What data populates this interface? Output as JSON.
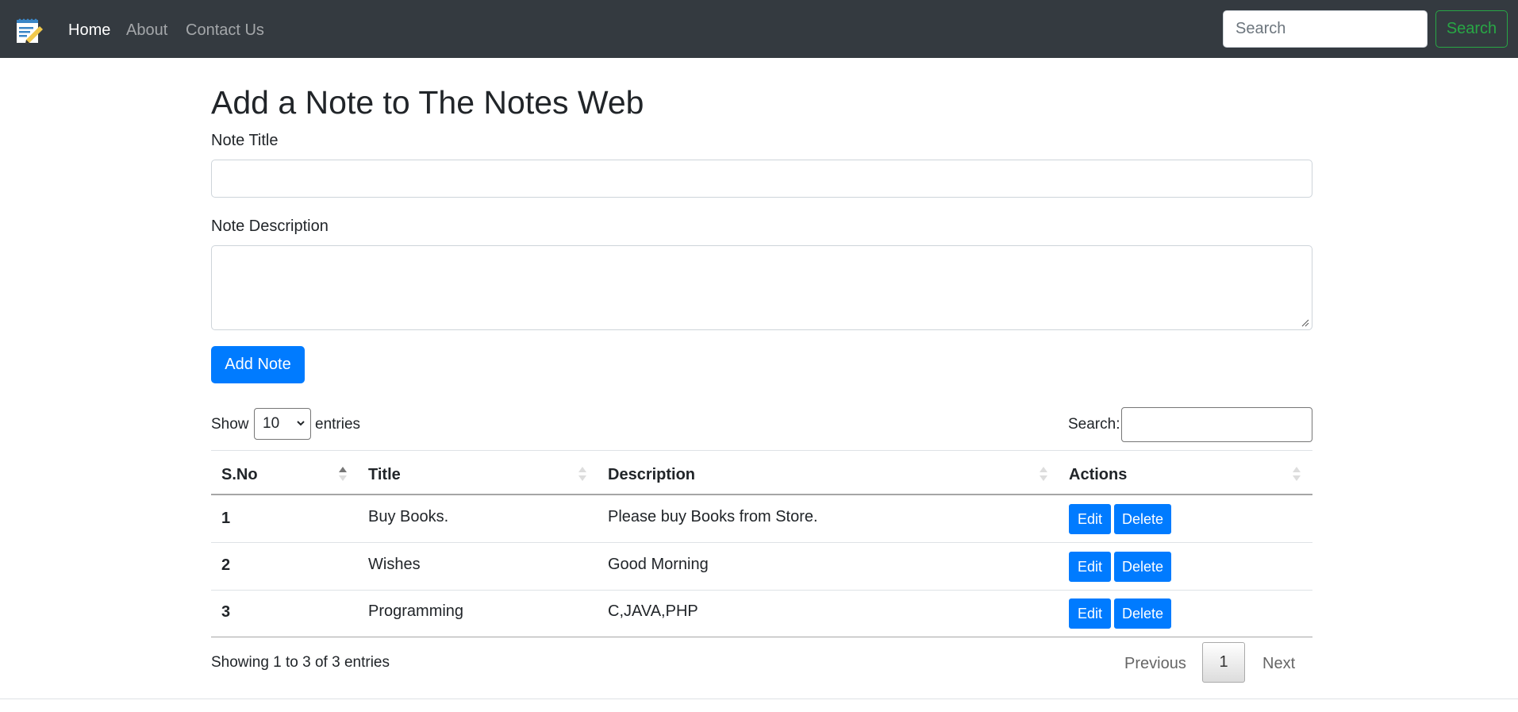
{
  "navbar": {
    "brand_icon": "notepad-pencil-icon",
    "links": [
      {
        "label": "Home",
        "active": true
      },
      {
        "label": "About",
        "active": false
      },
      {
        "label": "Contact Us",
        "active": false
      }
    ],
    "search_placeholder": "Search",
    "search_button": "Search",
    "bg_color": "#343a40",
    "search_button_color": "#28a745"
  },
  "form": {
    "heading": "Add a Note to The Notes Web",
    "title_label": "Note Title",
    "title_value": "",
    "description_label": "Note Description",
    "description_value": "",
    "submit_label": "Add Note",
    "accent_color": "#007bff"
  },
  "table_controls": {
    "show_label": "Show",
    "page_length": "10",
    "entries_label": "entries",
    "search_label": "Search:",
    "search_value": ""
  },
  "table": {
    "columns": [
      "S.No",
      "Title",
      "Description",
      "Actions"
    ],
    "rows": [
      {
        "sno": "1",
        "title": "Buy Books.",
        "description": "Please buy Books from Store.",
        "edit": "Edit",
        "delete": "Delete"
      },
      {
        "sno": "2",
        "title": "Wishes",
        "description": "Good Morning",
        "edit": "Edit",
        "delete": "Delete"
      },
      {
        "sno": "3",
        "title": "Programming",
        "description": "C,JAVA,PHP",
        "edit": "Edit",
        "delete": "Delete"
      }
    ]
  },
  "footer": {
    "info": "Showing 1 to 3 of 3 entries",
    "previous": "Previous",
    "current_page": "1",
    "next": "Next"
  }
}
